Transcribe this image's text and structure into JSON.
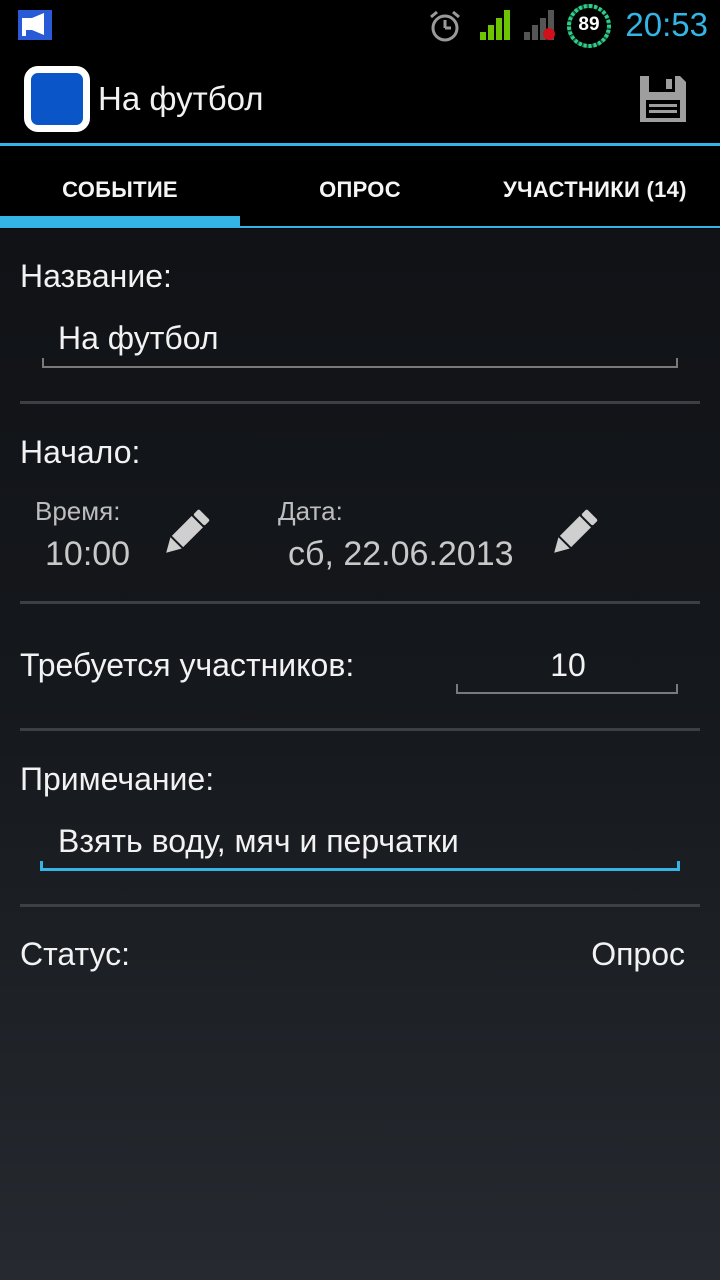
{
  "status_bar": {
    "time": "20:53",
    "battery": "89",
    "icons": [
      "notification-icon",
      "alarm-icon",
      "signal-icon",
      "signal-no-sim-icon",
      "battery-icon"
    ]
  },
  "action_bar": {
    "title": "На футбол",
    "icons": [
      "app-icon",
      "save-icon"
    ]
  },
  "tabs": [
    {
      "label": "СОБЫТИЕ",
      "selected": true
    },
    {
      "label": "ОПРОС",
      "selected": false
    },
    {
      "label": "УЧАСТНИКИ (14)",
      "selected": false
    }
  ],
  "form": {
    "name_label": "Название:",
    "name_value": "На футбол",
    "start_label": "Начало:",
    "time_label": "Время:",
    "time_value": "10:00",
    "date_label": "Дата:",
    "date_value": "сб, 22.06.2013",
    "required_label": "Требуется участников:",
    "required_value": "10",
    "note_label": "Примечание:",
    "note_value": "Взять воду, мяч и перчатки",
    "status_label": "Статус:",
    "status_value": "Опрос"
  },
  "colors": {
    "accent": "#33b5e5",
    "app_icon": "#0a56c9"
  }
}
